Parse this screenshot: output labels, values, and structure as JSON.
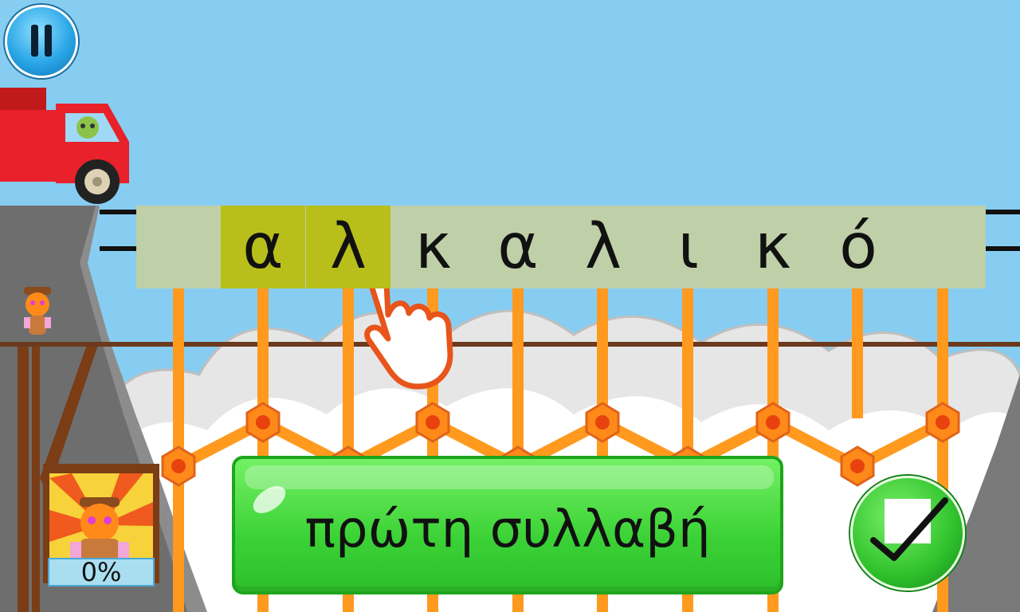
{
  "game": {
    "word_tiles": [
      {
        "letter": "",
        "selected": false
      },
      {
        "letter": "α",
        "selected": true
      },
      {
        "letter": "λ",
        "selected": true
      },
      {
        "letter": "κ",
        "selected": false
      },
      {
        "letter": "α",
        "selected": false
      },
      {
        "letter": "λ",
        "selected": false
      },
      {
        "letter": "ι",
        "selected": false
      },
      {
        "letter": "κ",
        "selected": false
      },
      {
        "letter": "ό",
        "selected": false
      },
      {
        "letter": "",
        "selected": false
      }
    ],
    "instruction": "πρώτη συλλαβή",
    "progress_text": "0%",
    "progress": 0
  },
  "icons": {
    "pause": "pause-icon",
    "confirm": "checkmark-icon",
    "hint": "pointing-hand-icon",
    "vehicle": "red-truck",
    "character": "player-character"
  },
  "colors": {
    "sky": "#87cdf2",
    "tile_bg": "#bfcfa8",
    "tile_selected": "#b8bf1a",
    "bridge_orange": "#ff9a1f",
    "button_green": "#3bd236",
    "truck_red": "#e8212a"
  }
}
